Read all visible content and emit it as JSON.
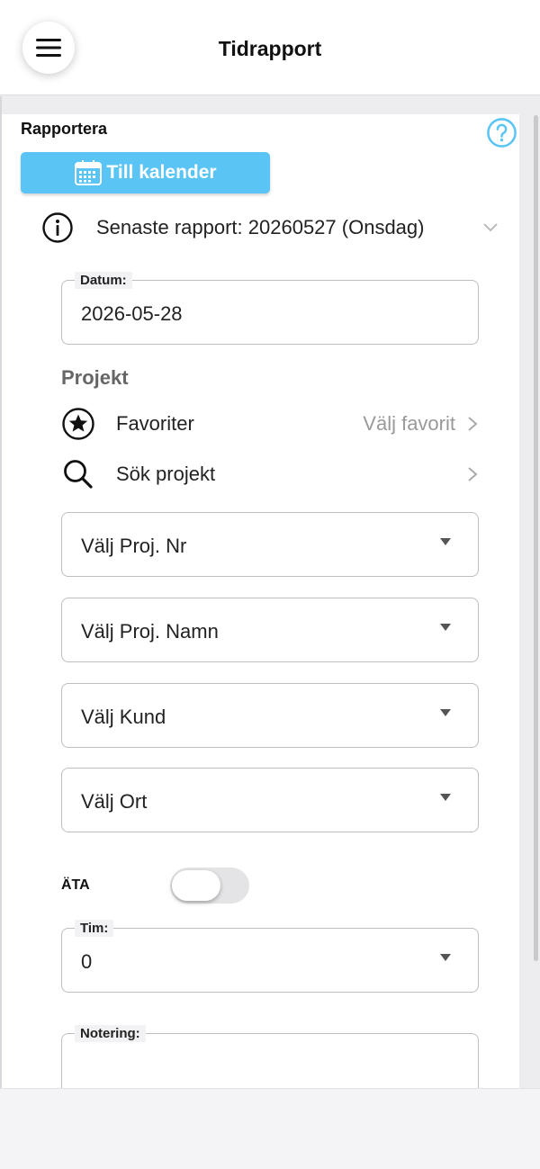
{
  "header": {
    "title": "Tidrapport"
  },
  "section": {
    "label": "Rapportera"
  },
  "calendar_button": {
    "label": "Till kalender"
  },
  "last_report": {
    "text": "Senaste rapport: 20260527 (Onsdag)"
  },
  "date_field": {
    "legend": "Datum:",
    "value": "2026-05-28"
  },
  "project": {
    "heading": "Projekt",
    "favorites": {
      "label": "Favoriter",
      "hint": "Välj favorit"
    },
    "search": {
      "label": "Sök projekt"
    }
  },
  "selects": [
    {
      "placeholder": "Välj Proj. Nr"
    },
    {
      "placeholder": "Välj Proj. Namn"
    },
    {
      "placeholder": "Välj Kund"
    },
    {
      "placeholder": "Välj Ort"
    }
  ],
  "ata": {
    "label": "ÄTA",
    "enabled": false
  },
  "hours_field": {
    "legend": "Tim:",
    "value": "0"
  },
  "note_field": {
    "legend": "Notering:",
    "value": ""
  },
  "colors": {
    "accent": "#5ac5f5",
    "border": "#bdbdc2",
    "muted": "#999999"
  },
  "icons": {
    "menu": "hamburger-icon",
    "help": "question-circle-icon",
    "calendar": "calendar-icon",
    "info": "info-circle-icon",
    "chevron": "chevron-down-icon",
    "star": "star-circle-icon",
    "search": "search-icon",
    "arrow": "chevron-right-icon",
    "caret": "caret-down-icon"
  }
}
